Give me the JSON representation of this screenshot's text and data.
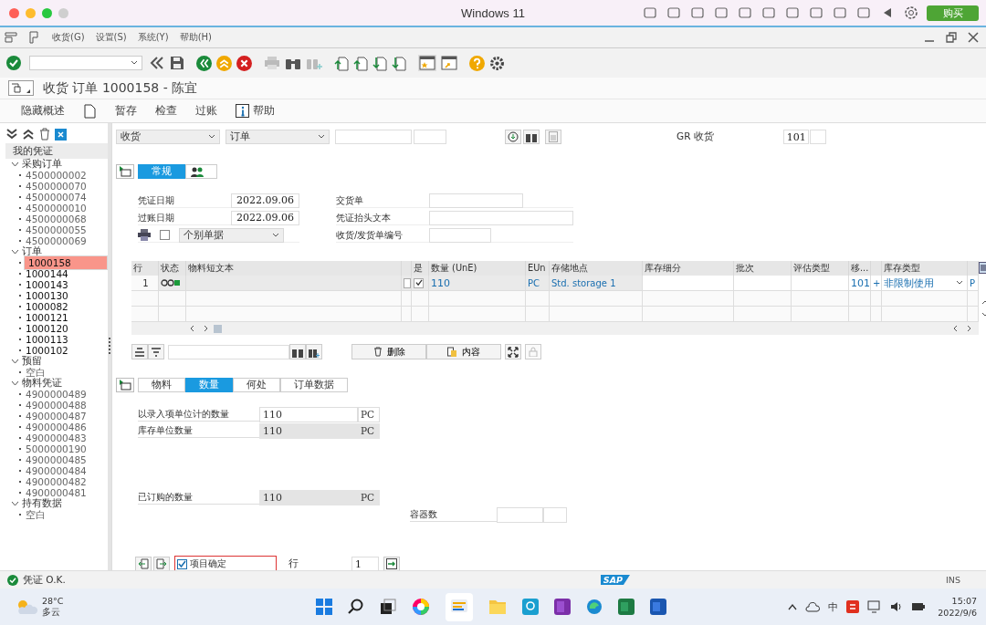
{
  "host_window": {
    "title": "Windows 11",
    "buy_button": "购买"
  },
  "menu_bar": [
    "收货(G)",
    "设置(S)",
    "系统(Y)",
    "帮助(H)"
  ],
  "screen_title": "收货 订单 1000158 - 陈宜",
  "app_toolbar": [
    {
      "kind": "text",
      "label": "隐藏概述"
    },
    {
      "kind": "icon"
    },
    {
      "kind": "text",
      "label": "暂存"
    },
    {
      "kind": "text",
      "label": "检查"
    },
    {
      "kind": "text",
      "label": "过账"
    },
    {
      "kind": "info",
      "label": "帮助"
    }
  ],
  "tree": {
    "title": "我的凭证",
    "groups": [
      {
        "label": "采购订单",
        "expanded": true,
        "children": [
          {
            "label": "4500000002",
            "selected": false
          },
          {
            "label": "4500000070",
            "selected": false
          },
          {
            "label": "4500000074",
            "selected": false
          },
          {
            "label": "4500000010",
            "selected": false
          },
          {
            "label": "4500000068",
            "selected": false
          },
          {
            "label": "4500000055",
            "selected": false
          },
          {
            "label": "4500000069",
            "selected": false
          }
        ]
      },
      {
        "label": "订单",
        "expanded": true,
        "children": [
          {
            "label": "1000158",
            "selected": true
          },
          {
            "label": "1000144",
            "selected": false
          },
          {
            "label": "1000143",
            "selected": false
          },
          {
            "label": "1000130",
            "selected": false
          },
          {
            "label": "1000082",
            "selected": false
          },
          {
            "label": "1000121",
            "selected": false
          },
          {
            "label": "1000120",
            "selected": false
          },
          {
            "label": "1000113",
            "selected": false
          },
          {
            "label": "1000102",
            "selected": false
          }
        ]
      },
      {
        "label": "预留",
        "expanded": true,
        "children": [
          {
            "label": "空白",
            "selected": false
          }
        ]
      },
      {
        "label": "物料凭证",
        "expanded": true,
        "children": [
          {
            "label": "4900000489",
            "selected": false
          },
          {
            "label": "4900000488",
            "selected": false
          },
          {
            "label": "4900000487",
            "selected": false
          },
          {
            "label": "4900000486",
            "selected": false
          },
          {
            "label": "4900000483",
            "selected": false
          },
          {
            "label": "5000000190",
            "selected": false
          },
          {
            "label": "4900000485",
            "selected": false
          },
          {
            "label": "4900000484",
            "selected": false
          },
          {
            "label": "4900000482",
            "selected": false
          },
          {
            "label": "4900000481",
            "selected": false
          }
        ]
      },
      {
        "label": "持有数据",
        "expanded": true,
        "children": [
          {
            "label": "空白",
            "selected": false
          }
        ]
      }
    ]
  },
  "header": {
    "action": "收货",
    "reference": "订单",
    "gr_label": "GR 收货",
    "movement_type": "101"
  },
  "header_tabs": [
    {
      "kind": "text",
      "label": "常规",
      "selected": true
    },
    {
      "kind": "icon",
      "selected": false
    }
  ],
  "general": {
    "left_fields": [
      {
        "label": "凭证日期",
        "value": "2022.09.06"
      },
      {
        "label": "过账日期",
        "value": "2022.09.06"
      }
    ],
    "print_checked": false,
    "print_mode": "个别单据",
    "right_fields": [
      {
        "label": "交货单"
      },
      {
        "label": "凭证抬头文本"
      },
      {
        "label": "收货/发货单编号"
      }
    ]
  },
  "grid": {
    "columns": [
      "行",
      "状态",
      "物料短文本",
      "",
      "是",
      "数量 (UnE)",
      "EUn",
      "存储地点",
      "库存细分",
      "批次",
      "评估类型",
      "移...",
      "",
      "库存类型",
      ""
    ],
    "rows": [
      {
        "line": "1",
        "column_4_checked": false,
        "ok_checked": true,
        "quantity": "110",
        "unit": "PC",
        "storage_location": "Std. storage 1",
        "movement_type": "101",
        "plus": "+",
        "stock_type": "非限制使用",
        "last": "P"
      }
    ],
    "buttons": [
      "删除",
      "内容"
    ]
  },
  "item_tabs": [
    {
      "label": "物料",
      "selected": false
    },
    {
      "label": "数量",
      "selected": true
    },
    {
      "label": "何处",
      "selected": false
    },
    {
      "label": "订单数据",
      "selected": false
    }
  ],
  "quantities": [
    {
      "label": "以录入项单位计的数量",
      "value": "110",
      "unit": "PC",
      "editable": true
    },
    {
      "label": "库存单位数量",
      "value": "110",
      "unit": "PC",
      "editable": false
    }
  ],
  "ordered": {
    "label": "已订购的数量",
    "value": "110",
    "unit": "PC"
  },
  "containers": {
    "label": "容器数"
  },
  "item_ok": {
    "label": "项目确定",
    "checked": true
  },
  "line_field": {
    "label": "行",
    "value": "1"
  },
  "status_bar": {
    "message": "凭证 O.K.",
    "logo": "SAP",
    "mode": "INS"
  },
  "taskbar": {
    "temperature": "28°C",
    "weather": "多云",
    "ime": "中",
    "time": "15:07",
    "date": "2022/9/6"
  }
}
